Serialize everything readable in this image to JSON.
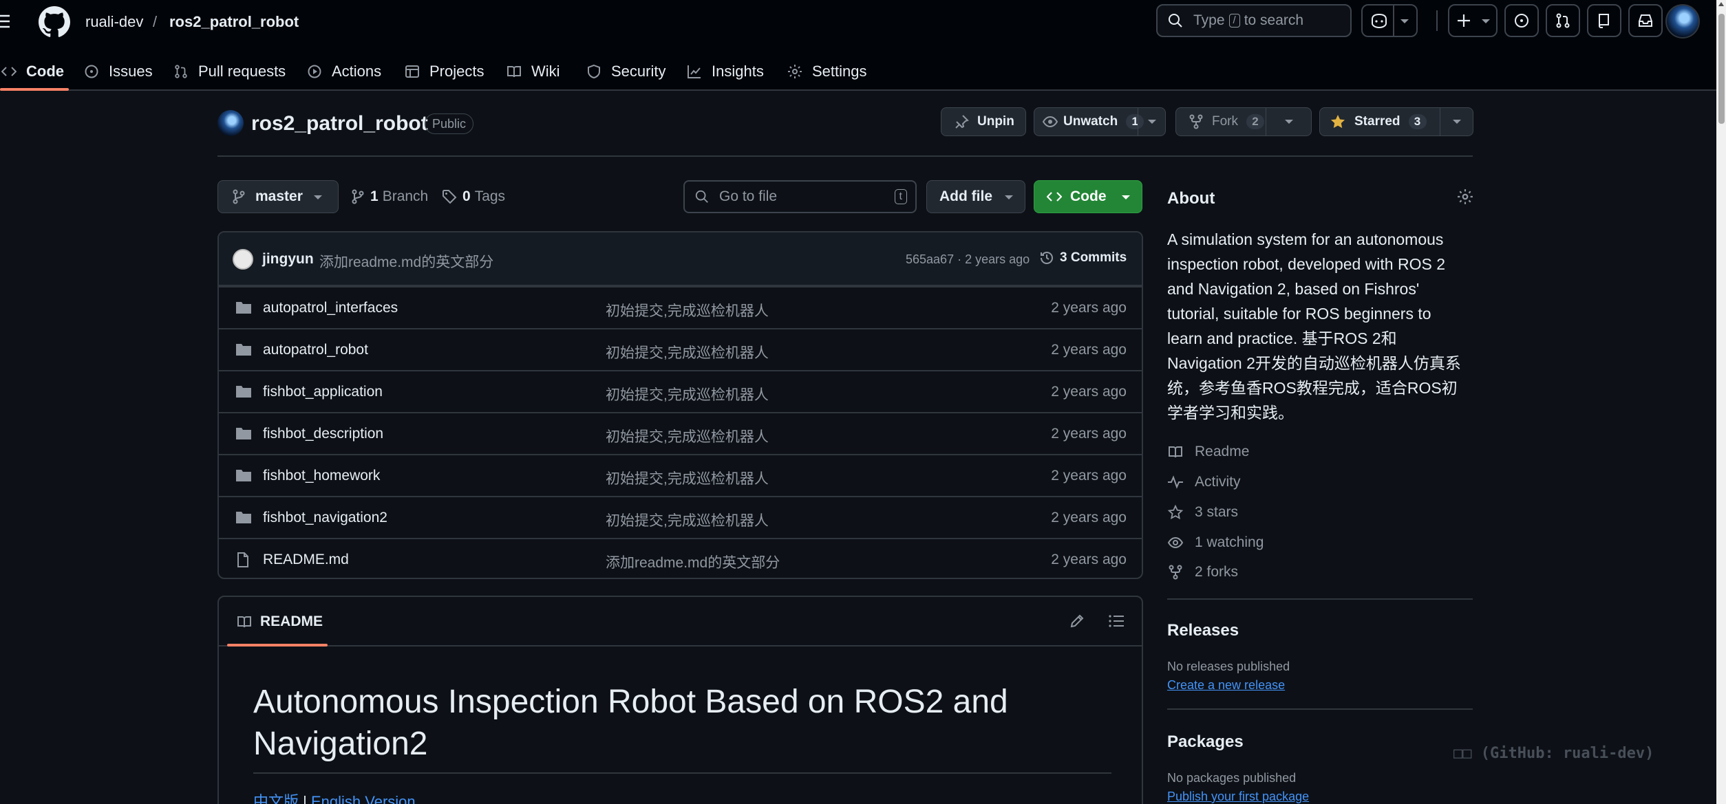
{
  "header": {
    "owner": "ruali-dev",
    "separator": "/",
    "repo": "ros2_patrol_robot",
    "search_prefix": "Type",
    "search_key": "/",
    "search_suffix": "to search"
  },
  "tabs": [
    {
      "label": "Code",
      "icon": "code-icon"
    },
    {
      "label": "Issues",
      "icon": "issue-opened-icon"
    },
    {
      "label": "Pull requests",
      "icon": "git-pull-request-icon"
    },
    {
      "label": "Actions",
      "icon": "play-icon"
    },
    {
      "label": "Projects",
      "icon": "table-icon"
    },
    {
      "label": "Wiki",
      "icon": "book-icon"
    },
    {
      "label": "Security",
      "icon": "shield-icon"
    },
    {
      "label": "Insights",
      "icon": "graph-icon"
    },
    {
      "label": "Settings",
      "icon": "gear-icon"
    }
  ],
  "repo_head": {
    "name": "ros2_patrol_robot",
    "visibility": "Public",
    "unpin": "Unpin",
    "unwatch": "Unwatch",
    "watch_count": "1",
    "fork": "Fork",
    "fork_count": "2",
    "starred": "Starred",
    "star_count": "3"
  },
  "filenav": {
    "branch": "master",
    "branch_count": "1",
    "branch_label": "Branch",
    "tag_count": "0",
    "tag_label": "Tags",
    "goto_placeholder": "Go to file",
    "goto_key": "t",
    "add_file": "Add file",
    "code": "Code"
  },
  "commit": {
    "author": "jingyun",
    "message": "添加readme.md的英文部分",
    "hash_age": "565aa67 · 2 years ago",
    "count": "3 Commits"
  },
  "files": [
    {
      "name": "autopatrol_interfaces",
      "type": "folder",
      "message": "初始提交,完成巡检机器人",
      "age": "2 years ago"
    },
    {
      "name": "autopatrol_robot",
      "type": "folder",
      "message": "初始提交,完成巡检机器人",
      "age": "2 years ago"
    },
    {
      "name": "fishbot_application",
      "type": "folder",
      "message": "初始提交,完成巡检机器人",
      "age": "2 years ago"
    },
    {
      "name": "fishbot_description",
      "type": "folder",
      "message": "初始提交,完成巡检机器人",
      "age": "2 years ago"
    },
    {
      "name": "fishbot_homework",
      "type": "folder",
      "message": "初始提交,完成巡检机器人",
      "age": "2 years ago"
    },
    {
      "name": "fishbot_navigation2",
      "type": "folder",
      "message": "初始提交,完成巡检机器人",
      "age": "2 years ago"
    },
    {
      "name": "README.md",
      "type": "file",
      "message": "添加readme.md的英文部分",
      "age": "2 years ago"
    }
  ],
  "readme": {
    "tab": "README",
    "title": "Autonomous Inspection Robot Based on ROS2 and Navigation2",
    "link_cn": "中文版",
    "link_sep": "|",
    "link_en": "English Version"
  },
  "about": {
    "title": "About",
    "description": "A simulation system for an autonomous inspection robot, developed with ROS 2 and Navigation 2, based on Fishros' tutorial, suitable for ROS beginners to learn and practice. 基于ROS 2和Navigation 2开发的自动巡检机器人仿真系统，参考鱼香ROS教程完成，适合ROS初学者学习和实践。",
    "links": [
      {
        "label": "Readme",
        "icon": "book-icon"
      },
      {
        "label": "Activity",
        "icon": "pulse-icon"
      },
      {
        "label": "3 stars",
        "icon": "star-icon"
      },
      {
        "label": "1 watching",
        "icon": "eye-icon"
      },
      {
        "label": "2 forks",
        "icon": "repo-forked-icon"
      }
    ]
  },
  "releases": {
    "title": "Releases",
    "note": "No releases published",
    "link": "Create a new release"
  },
  "packages": {
    "title": "Packages",
    "note": "No packages published",
    "link": "Publish your first package"
  },
  "watermark": "□□ (GitHub: ruali-dev)",
  "colors": {
    "background": "#0d1117",
    "header": "#010409",
    "border": "#30363d",
    "accent_tab": "#f78166",
    "link": "#4493f8",
    "primary_button": "#238636",
    "star": "#e3b341"
  }
}
